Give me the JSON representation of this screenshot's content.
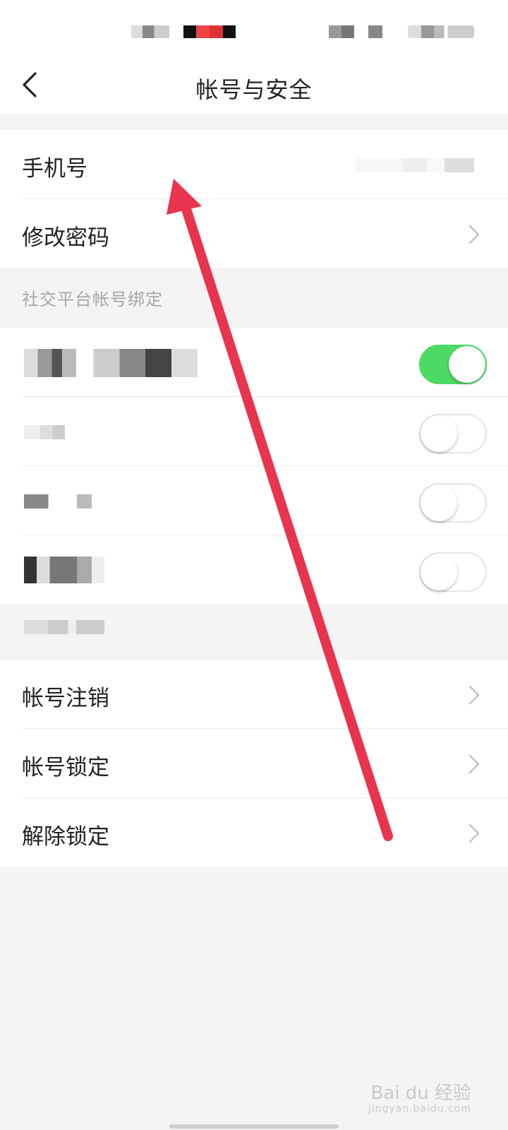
{
  "header": {
    "title": "帐号与安全"
  },
  "account": {
    "phone_label": "手机号",
    "change_password_label": "修改密码"
  },
  "social": {
    "section_title": "社交平台帐号绑定",
    "toggles": [
      {
        "state": "on"
      },
      {
        "state": "off"
      },
      {
        "state": "off"
      },
      {
        "state": "off"
      }
    ]
  },
  "more": {
    "items": [
      {
        "label": "帐号注销"
      },
      {
        "label": "帐号锁定"
      },
      {
        "label": "解除锁定"
      }
    ]
  },
  "colors": {
    "accent_green": "#4cd964",
    "annotation_red": "#e8344e",
    "background": "#f4f4f5"
  },
  "watermark": {
    "brand": "Bai du 经验",
    "url": "jingyan.baidu.com"
  }
}
